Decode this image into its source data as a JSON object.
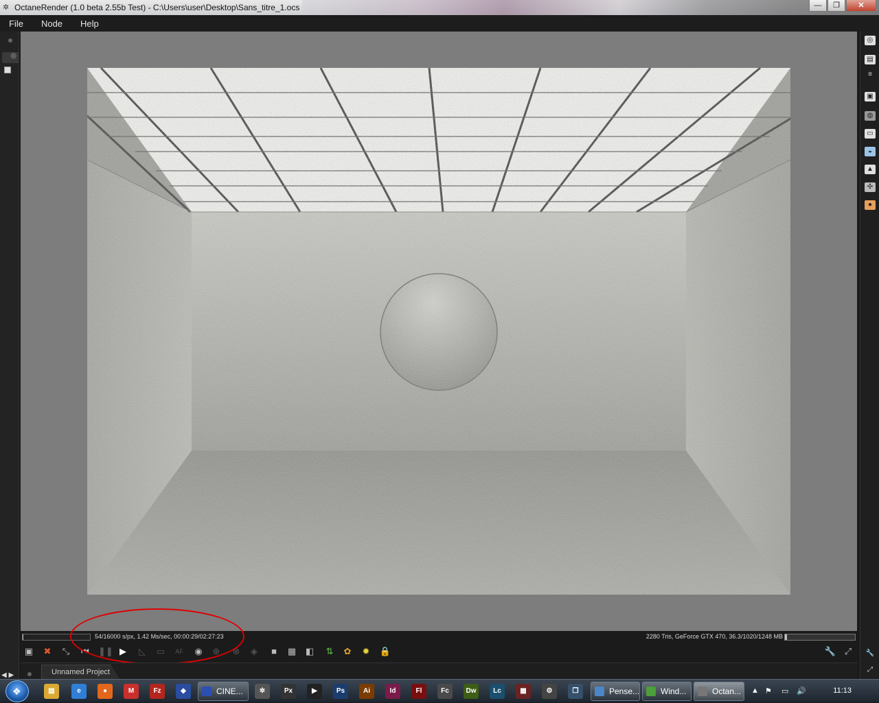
{
  "window": {
    "title": "OctaneRender (1.0 beta 2.55b Test) - C:\\Users\\user\\Desktop\\Sans_titre_1.ocs",
    "minimize_glyph": "—",
    "maximize_glyph": "❐",
    "close_glyph": "✕"
  },
  "menu": {
    "items": [
      "File",
      "Node",
      "Help"
    ]
  },
  "status": {
    "render_stats": "54/16000 s/px, 1.42 Ms/sec, 00:00:29/02:27:23",
    "scene_stats": "2280 Tris, GeForce GTX 470, 36.3/1020/1248 MB",
    "render_progress": 0.0034,
    "memory_used_fraction": 0.03
  },
  "toolbar": {
    "icons": [
      "save-render-icon",
      "cancel-render-icon",
      "recenter-view-icon",
      "restart-render-icon",
      "pause-render-icon",
      "start-render-icon",
      "pick-focus-icon",
      "film-region-icon",
      "autofocus-icon",
      "camera-target-icon",
      "pick-white-balance-icon",
      "lock-viewport-icon",
      "material-picker-icon",
      "object-picker-icon",
      "alpha-channel-icon",
      "checker-icon",
      "overlay-icon",
      "import-icon",
      "palette-icon",
      "sun-icon",
      "lock-icon",
      "wrench-icon",
      "fullscreen-icon"
    ]
  },
  "project": {
    "tab_label": "Unnamed Project"
  },
  "taskbar": {
    "tasks": [
      {
        "label": "CINE...",
        "color": "#2b4fb2"
      },
      {
        "label": "Pense...",
        "color": "#4b86c8"
      },
      {
        "label": "Wind...",
        "color": "#4c9f3a"
      },
      {
        "label": "Octan...",
        "color": "#777777"
      }
    ],
    "quicklaunch": [
      {
        "name": "explorer-icon",
        "glyph": "▤",
        "color": "#d9a933"
      },
      {
        "name": "ie-icon",
        "glyph": "e",
        "color": "#2f7fd6"
      },
      {
        "name": "firefox-icon",
        "glyph": "●",
        "color": "#e2671d"
      },
      {
        "name": "gmail-icon",
        "glyph": "M",
        "color": "#c9302c"
      },
      {
        "name": "filezilla-icon",
        "glyph": "Fz",
        "color": "#b3261e"
      },
      {
        "name": "app-icon",
        "glyph": "◆",
        "color": "#2a4da0"
      }
    ],
    "apps": [
      {
        "name": "octane-launcher-icon",
        "glyph": "✲",
        "color": "#555"
      },
      {
        "name": "pixel-icon",
        "glyph": "Px",
        "color": "#333"
      },
      {
        "name": "media-player-icon",
        "glyph": "▶",
        "color": "#222"
      },
      {
        "name": "photoshop-icon",
        "glyph": "Ps",
        "color": "#1b3d6e"
      },
      {
        "name": "illustrator-icon",
        "glyph": "Ai",
        "color": "#7a3c00"
      },
      {
        "name": "indesign-icon",
        "glyph": "Id",
        "color": "#7a1b4a"
      },
      {
        "name": "flash-icon",
        "glyph": "Fl",
        "color": "#7a0f0f"
      },
      {
        "name": "fireworks-icon",
        "glyph": "Fc",
        "color": "#4a4a4a"
      },
      {
        "name": "dreamweaver-icon",
        "glyph": "Dw",
        "color": "#3e5d16"
      },
      {
        "name": "livecycle-icon",
        "glyph": "Lc",
        "color": "#1b4f6e"
      },
      {
        "name": "archive-icon",
        "glyph": "▦",
        "color": "#6a2222"
      },
      {
        "name": "gear-app-icon",
        "glyph": "⚙",
        "color": "#444"
      },
      {
        "name": "window-app-icon",
        "glyph": "❐",
        "color": "#35506a"
      }
    ],
    "clock": "11:13"
  },
  "colors": {
    "annotation": "#e00000",
    "viewport_bg": "#7d7d7d"
  }
}
